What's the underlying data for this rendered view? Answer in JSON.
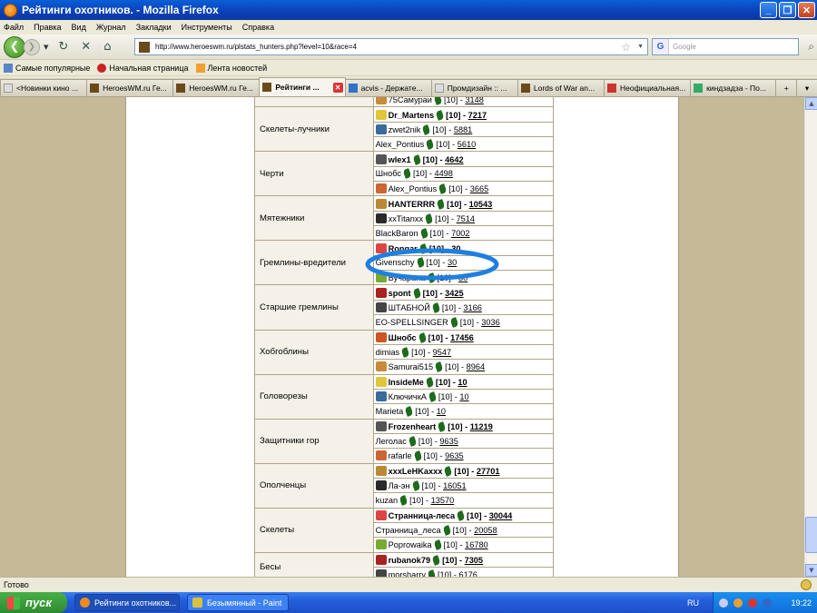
{
  "window": {
    "title": "Рейтинги охотников. - Mozilla Firefox"
  },
  "menu": [
    "Файл",
    "Правка",
    "Вид",
    "Журнал",
    "Закладки",
    "Инструменты",
    "Справка"
  ],
  "nav": {
    "url": "http://www.heroeswm.ru/plstats_hunters.php?level=10&race=4",
    "search_placeholder": "Google"
  },
  "bookmarks": [
    "Самые популярные",
    "Начальная страница",
    "Лента новостей"
  ],
  "tabs": [
    "<Новинки кино ...",
    "HeroesWM.ru Ге...",
    "HeroesWM.ru Ге...",
    "Рейтинги ...",
    "acvis - Держате...",
    "Промдизайн :: ...",
    "Lords of War an...",
    "Неофициальная...",
    "киндзадза - По..."
  ],
  "table": {
    "groups": [
      {
        "cat": "",
        "rows": [
          {
            "name": "75Самураи",
            "lvl": "[10]",
            "score": "3148",
            "top": false
          }
        ]
      },
      {
        "cat": "Скелеты-лучники",
        "rows": [
          {
            "name": "Dr_Martens",
            "lvl": "[10]",
            "score": "7217",
            "top": true
          },
          {
            "name": "zwet2nik",
            "lvl": "[10]",
            "score": "5881",
            "top": false
          },
          {
            "name": "Alex_Pontius",
            "lvl": "[10]",
            "score": "5610",
            "top": false
          }
        ]
      },
      {
        "cat": "Черти",
        "rows": [
          {
            "name": "wlex1",
            "lvl": "[10]",
            "score": "4642",
            "top": true
          },
          {
            "name": "Шнобс",
            "lvl": "[10]",
            "score": "4498",
            "top": false
          },
          {
            "name": "Alex_Pontius",
            "lvl": "[10]",
            "score": "3665",
            "top": false
          }
        ]
      },
      {
        "cat": "Мятежники",
        "rows": [
          {
            "name": "HANTERRR",
            "lvl": "[10]",
            "score": "10543",
            "top": true
          },
          {
            "name": "xxTitanxx",
            "lvl": "[10]",
            "score": "7514",
            "top": false
          },
          {
            "name": "BlackBaron",
            "lvl": "[10]",
            "score": "7002",
            "top": false
          }
        ]
      },
      {
        "cat": "Гремлины-вредители",
        "rows": [
          {
            "name": "Rongar",
            "lvl": "[10]",
            "score": "30",
            "top": true
          },
          {
            "name": "Givenschy",
            "lvl": "[10]",
            "score": "30",
            "top": false
          },
          {
            "name": "Вучарана",
            "lvl": "[10]",
            "score": "30",
            "top": false
          }
        ]
      },
      {
        "cat": "Старшие гремлины",
        "rows": [
          {
            "name": "spont",
            "lvl": "[10]",
            "score": "3425",
            "top": true
          },
          {
            "name": "ШТАБНОЙ",
            "lvl": "[10]",
            "score": "3166",
            "top": false
          },
          {
            "name": "EO-SPELLSINGER",
            "lvl": "[10]",
            "score": "3036",
            "top": false
          }
        ]
      },
      {
        "cat": "Хобгоблины",
        "rows": [
          {
            "name": "Шнобс",
            "lvl": "[10]",
            "score": "17456",
            "top": true
          },
          {
            "name": "dimias",
            "lvl": "[10]",
            "score": "9547",
            "top": false
          },
          {
            "name": "Samurai515",
            "lvl": "[10]",
            "score": "8964",
            "top": false
          }
        ]
      },
      {
        "cat": "Головорезы",
        "rows": [
          {
            "name": "InsideMe",
            "lvl": "[10]",
            "score": "10",
            "top": true
          },
          {
            "name": "КлючичкА",
            "lvl": "[10]",
            "score": "10",
            "top": false
          },
          {
            "name": "Marieta",
            "lvl": "[10]",
            "score": "10",
            "top": false
          }
        ]
      },
      {
        "cat": "Защитники гор",
        "rows": [
          {
            "name": "Frozenheart",
            "lvl": "[10]",
            "score": "11219",
            "top": true
          },
          {
            "name": "Леголас",
            "lvl": "[10]",
            "score": "9635",
            "top": false
          },
          {
            "name": "rafarle",
            "lvl": "[10]",
            "score": "9635",
            "top": false
          }
        ]
      },
      {
        "cat": "Ополченцы",
        "rows": [
          {
            "name": "xxxLeHKaxxx",
            "lvl": "[10]",
            "score": "27701",
            "top": true
          },
          {
            "name": "Ла-эн",
            "lvl": "[10]",
            "score": "16051",
            "top": false
          },
          {
            "name": "kuzan",
            "lvl": "[10]",
            "score": "13570",
            "top": false
          }
        ]
      },
      {
        "cat": "Скелеты",
        "rows": [
          {
            "name": "Странница-леса",
            "lvl": "[10]",
            "score": "30044",
            "top": true
          },
          {
            "name": "Странница_леса",
            "lvl": "[10]",
            "score": "20058",
            "top": false
          },
          {
            "name": "Poprowaika",
            "lvl": "[10]",
            "score": "16780",
            "top": false
          }
        ]
      },
      {
        "cat": "Бесы",
        "rows": [
          {
            "name": "rubanok79",
            "lvl": "[10]",
            "score": "7305",
            "top": true
          },
          {
            "name": "morsharry",
            "lvl": "[10]",
            "score": "6176",
            "top": false
          }
        ]
      }
    ]
  },
  "status": "Готово",
  "taskbar": {
    "start": "пуск",
    "items": [
      "Рейтинги охотников...",
      "Безымянный - Paint"
    ],
    "lang": "RU",
    "clock": "19:22"
  }
}
